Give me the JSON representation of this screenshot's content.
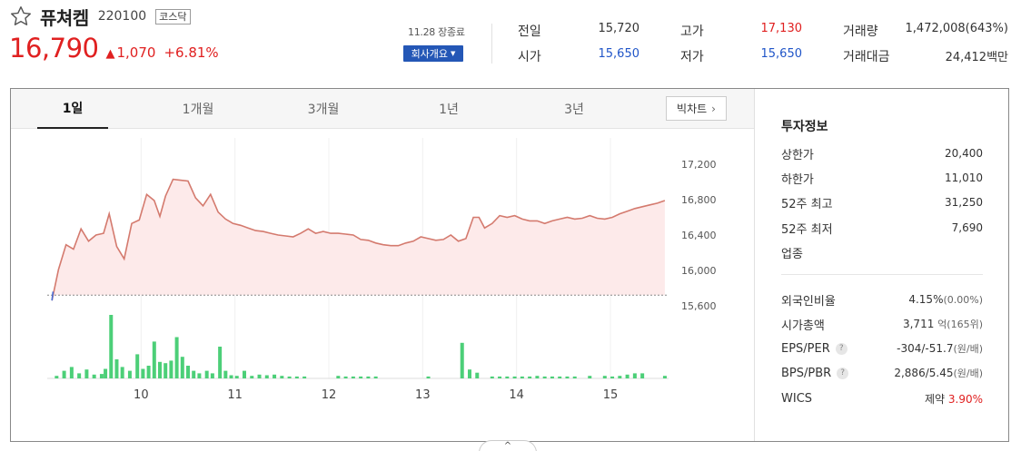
{
  "stock": {
    "name": "퓨쳐켐",
    "code": "220100",
    "market": "코스닥",
    "price": "16,790",
    "change": "1,070",
    "change_pct": "+6.81%",
    "date_status": "11.28 장종료",
    "company_button": "회사개요"
  },
  "quote": {
    "prev_label": "전일",
    "prev": "15,720",
    "high_label": "고가",
    "high": "17,130",
    "volume_label": "거래량",
    "volume": "1,472,008(643%)",
    "open_label": "시가",
    "open": "15,650",
    "low_label": "저가",
    "low": "15,650",
    "amount_label": "거래대금",
    "amount": "24,412백만"
  },
  "tabs": [
    {
      "label": "1일"
    },
    {
      "label": "1개월"
    },
    {
      "label": "3개월"
    },
    {
      "label": "1년"
    },
    {
      "label": "3년"
    }
  ],
  "big_chart_label": "빅차트",
  "invest": {
    "title": "투자정보",
    "upper_label": "상한가",
    "upper": "20,400",
    "lower_label": "하한가",
    "lower": "11,010",
    "w52_high_label": "52주 최고",
    "w52_high": "31,250",
    "w52_low_label": "52주 최저",
    "w52_low": "7,690",
    "sector_label": "업종",
    "foreign_label": "외국인비율",
    "foreign": "4.15%",
    "foreign_sub": "(0.00%)",
    "mktcap_label": "시가총액",
    "mktcap": "3,711",
    "mktcap_unit": "억(165위)",
    "eps_label": "EPS/PER",
    "eps": "-304/-51.7",
    "eps_unit": "(원/배)",
    "bps_label": "BPS/PBR",
    "bps": "2,886/5.45",
    "bps_unit": "(원/배)",
    "wics_label": "WICS",
    "wics": "제약",
    "wics_pct": "3.90%"
  },
  "colors": {
    "up": "#e02020",
    "down": "#2055c8",
    "price_line": "#d47a6e",
    "price_fill": "#fdeaea",
    "volume_bar": "#4ccf78",
    "accent_button": "#2457b6"
  },
  "chart_data": {
    "type": "line",
    "y_ticks": [
      "17,200",
      "16,800",
      "16,400",
      "16,000",
      "15,600"
    ],
    "x_ticks": [
      "10",
      "11",
      "12",
      "13",
      "14",
      "15"
    ],
    "ylim": [
      15600,
      17200
    ],
    "prev_close": 15720,
    "x_range": [
      9.0,
      15.6
    ],
    "price": [
      [
        9.05,
        15660
      ],
      [
        9.12,
        16010
      ],
      [
        9.2,
        16290
      ],
      [
        9.28,
        16240
      ],
      [
        9.36,
        16470
      ],
      [
        9.44,
        16330
      ],
      [
        9.52,
        16400
      ],
      [
        9.6,
        16420
      ],
      [
        9.66,
        16640
      ],
      [
        9.74,
        16270
      ],
      [
        9.82,
        16130
      ],
      [
        9.9,
        16530
      ],
      [
        9.98,
        16570
      ],
      [
        10.06,
        16860
      ],
      [
        10.14,
        16790
      ],
      [
        10.2,
        16610
      ],
      [
        10.26,
        16840
      ],
      [
        10.34,
        17030
      ],
      [
        10.42,
        17020
      ],
      [
        10.5,
        17010
      ],
      [
        10.58,
        16820
      ],
      [
        10.66,
        16730
      ],
      [
        10.74,
        16860
      ],
      [
        10.82,
        16660
      ],
      [
        10.9,
        16580
      ],
      [
        10.98,
        16530
      ],
      [
        11.06,
        16510
      ],
      [
        11.14,
        16480
      ],
      [
        11.22,
        16450
      ],
      [
        11.3,
        16440
      ],
      [
        11.38,
        16420
      ],
      [
        11.46,
        16400
      ],
      [
        11.54,
        16390
      ],
      [
        11.62,
        16380
      ],
      [
        11.7,
        16420
      ],
      [
        11.78,
        16470
      ],
      [
        11.86,
        16420
      ],
      [
        11.94,
        16440
      ],
      [
        12.02,
        16420
      ],
      [
        12.1,
        16420
      ],
      [
        12.18,
        16410
      ],
      [
        12.26,
        16400
      ],
      [
        12.34,
        16350
      ],
      [
        12.42,
        16340
      ],
      [
        12.5,
        16310
      ],
      [
        12.58,
        16290
      ],
      [
        12.66,
        16280
      ],
      [
        12.74,
        16280
      ],
      [
        12.82,
        16310
      ],
      [
        12.9,
        16330
      ],
      [
        12.98,
        16380
      ],
      [
        13.06,
        16360
      ],
      [
        13.14,
        16340
      ],
      [
        13.22,
        16350
      ],
      [
        13.3,
        16400
      ],
      [
        13.38,
        16330
      ],
      [
        13.46,
        16360
      ],
      [
        13.54,
        16600
      ],
      [
        13.6,
        16600
      ],
      [
        13.66,
        16480
      ],
      [
        13.74,
        16530
      ],
      [
        13.82,
        16620
      ],
      [
        13.9,
        16600
      ],
      [
        13.98,
        16620
      ],
      [
        14.06,
        16580
      ],
      [
        14.14,
        16560
      ],
      [
        14.22,
        16560
      ],
      [
        14.3,
        16530
      ],
      [
        14.38,
        16560
      ],
      [
        14.46,
        16580
      ],
      [
        14.54,
        16600
      ],
      [
        14.62,
        16580
      ],
      [
        14.7,
        16590
      ],
      [
        14.78,
        16620
      ],
      [
        14.86,
        16590
      ],
      [
        14.94,
        16580
      ],
      [
        15.02,
        16600
      ],
      [
        15.1,
        16640
      ],
      [
        15.18,
        16670
      ],
      [
        15.26,
        16700
      ],
      [
        15.34,
        16720
      ],
      [
        15.42,
        16740
      ],
      [
        15.5,
        16760
      ],
      [
        15.58,
        16790
      ]
    ],
    "volume": [
      [
        9.1,
        4
      ],
      [
        9.18,
        12
      ],
      [
        9.26,
        18
      ],
      [
        9.34,
        8
      ],
      [
        9.42,
        14
      ],
      [
        9.5,
        6
      ],
      [
        9.58,
        7
      ],
      [
        9.62,
        15
      ],
      [
        9.68,
        100
      ],
      [
        9.74,
        30
      ],
      [
        9.8,
        18
      ],
      [
        9.88,
        12
      ],
      [
        9.96,
        38
      ],
      [
        10.02,
        15
      ],
      [
        10.08,
        20
      ],
      [
        10.14,
        58
      ],
      [
        10.2,
        26
      ],
      [
        10.26,
        24
      ],
      [
        10.32,
        28
      ],
      [
        10.38,
        65
      ],
      [
        10.44,
        34
      ],
      [
        10.5,
        20
      ],
      [
        10.56,
        12
      ],
      [
        10.62,
        8
      ],
      [
        10.7,
        12
      ],
      [
        10.76,
        8
      ],
      [
        10.84,
        50
      ],
      [
        10.9,
        12
      ],
      [
        10.96,
        5
      ],
      [
        11.02,
        4
      ],
      [
        11.1,
        12
      ],
      [
        11.18,
        4
      ],
      [
        11.26,
        6
      ],
      [
        11.34,
        5
      ],
      [
        11.42,
        6
      ],
      [
        11.5,
        4
      ],
      [
        11.58,
        3
      ],
      [
        11.66,
        3
      ],
      [
        11.74,
        3
      ],
      [
        12.1,
        4
      ],
      [
        12.18,
        3
      ],
      [
        12.26,
        3
      ],
      [
        12.34,
        3
      ],
      [
        12.42,
        3
      ],
      [
        12.5,
        3
      ],
      [
        13.06,
        3
      ],
      [
        13.42,
        56
      ],
      [
        13.5,
        14
      ],
      [
        13.58,
        9
      ],
      [
        13.74,
        3
      ],
      [
        13.82,
        3
      ],
      [
        13.9,
        3
      ],
      [
        13.98,
        3
      ],
      [
        14.06,
        3
      ],
      [
        14.14,
        3
      ],
      [
        14.22,
        4
      ],
      [
        14.3,
        3
      ],
      [
        14.38,
        3
      ],
      [
        14.46,
        3
      ],
      [
        14.54,
        3
      ],
      [
        14.62,
        3
      ],
      [
        14.78,
        4
      ],
      [
        14.94,
        4
      ],
      [
        15.02,
        3
      ],
      [
        15.1,
        4
      ],
      [
        15.18,
        6
      ],
      [
        15.26,
        8
      ],
      [
        15.34,
        8
      ],
      [
        15.58,
        4
      ]
    ]
  }
}
